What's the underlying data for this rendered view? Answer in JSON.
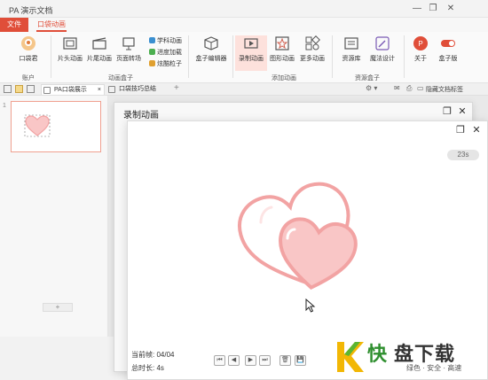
{
  "app": {
    "title": "PA 演示文档",
    "menu_file": "文件",
    "menu_active": "口袋动画 PA"
  },
  "ribbon": {
    "account": "口袋君",
    "account_group": "账户",
    "buttons": [
      {
        "label": "片头动画"
      },
      {
        "label": "片尾动画"
      },
      {
        "label": "页面转场"
      }
    ],
    "small_items": [
      "学科动画",
      "进度加载",
      "炫酷粒子"
    ],
    "anim_group": "动画盒子",
    "box_editor": "盒子编辑器",
    "add_buttons": [
      {
        "label": "录制动画"
      },
      {
        "label": "图形动画"
      },
      {
        "label": "更多动画"
      }
    ],
    "add_group": "添加动画",
    "res_buttons": [
      {
        "label": "资源库"
      },
      {
        "label": "魔法设计"
      }
    ],
    "res_group": "资源盒子",
    "about": "关于",
    "box_edition": "盒子版"
  },
  "doc_tabs": [
    "PA口袋展示",
    "口袋技巧总结"
  ],
  "hide_tab_label": "隐藏文档标签",
  "slide_panel": {
    "slide_number": "1",
    "add_label": "+"
  },
  "dialog_back": {
    "title": "录制动画"
  },
  "dialog_front": {
    "duration_badge": "23s",
    "current_frame": "当前帧: 04/04",
    "total_time": "总时长: 4s",
    "controls": [
      "⏮",
      "◀",
      "▶",
      "⏭",
      "🗑",
      "💾"
    ]
  },
  "watermark": {
    "brand_1": "快",
    "brand_2": "盘下载",
    "slogan": "绿色 · 安全 · 高速"
  },
  "colors": {
    "accent": "#e04e39",
    "heart": "#f2a3a3",
    "heart_fill": "#f9c6c6"
  }
}
